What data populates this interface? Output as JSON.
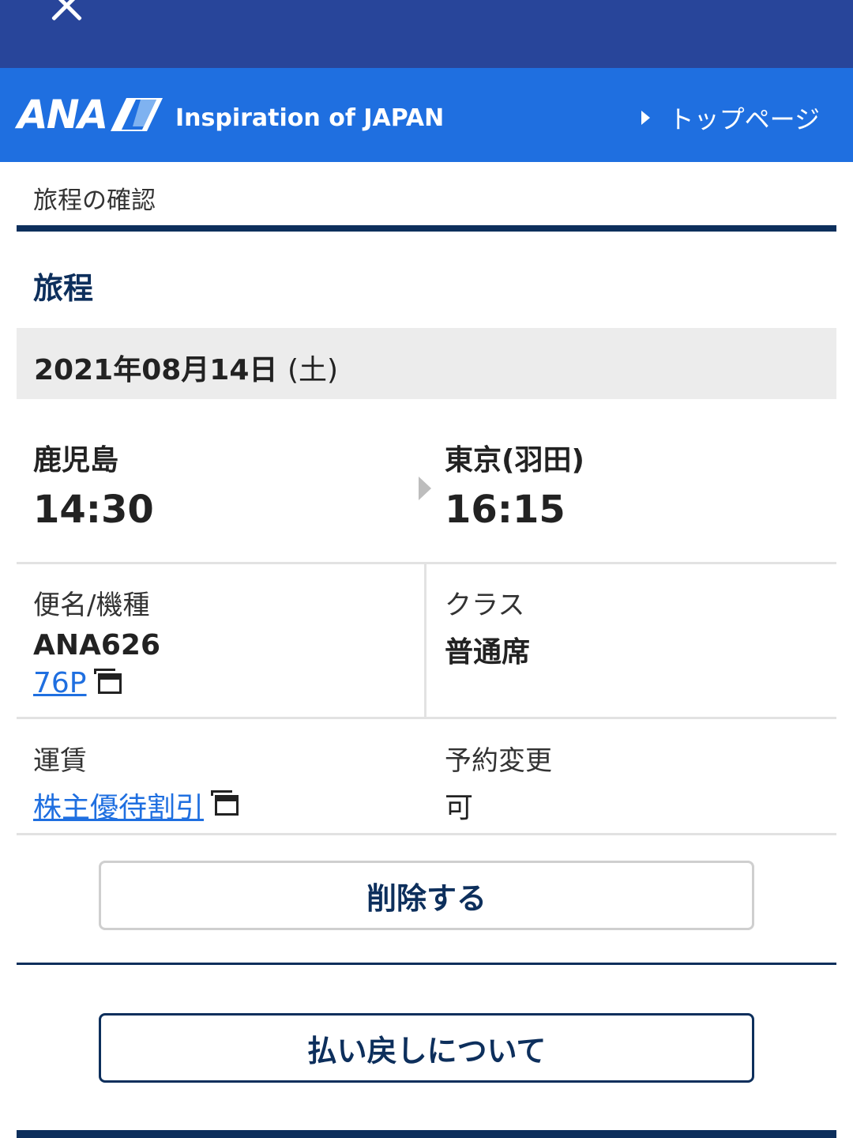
{
  "colors": {
    "topbar": "#28459a",
    "header": "#1f6fe0",
    "navy": "#0d2f5c",
    "link": "#1f6fe0",
    "date_band": "#ececec"
  },
  "topbar": {
    "close_icon": "close-icon"
  },
  "header": {
    "logo_text": "ANA",
    "logo_mark_icon": "ana-logo-mark",
    "tagline": "Inspiration of JAPAN",
    "top_link": "トップページ"
  },
  "breadcrumb": "旅程の確認",
  "section_title": "旅程",
  "itinerary": {
    "date": "2021年08月14日",
    "day_of_week": "(土)",
    "departure": {
      "city": "鹿児島",
      "time": "14:30"
    },
    "arrival": {
      "city": "東京(羽田)",
      "time": "16:15"
    },
    "flight": {
      "label": "便名/機種",
      "number": "ANA626",
      "aircraft": "76P"
    },
    "class": {
      "label": "クラス",
      "value": "普通席"
    },
    "fare": {
      "label": "運賃",
      "value": "株主優待割引"
    },
    "change": {
      "label": "予約変更",
      "value": "可"
    }
  },
  "buttons": {
    "delete": "削除する",
    "refund": "払い戻しについて"
  }
}
